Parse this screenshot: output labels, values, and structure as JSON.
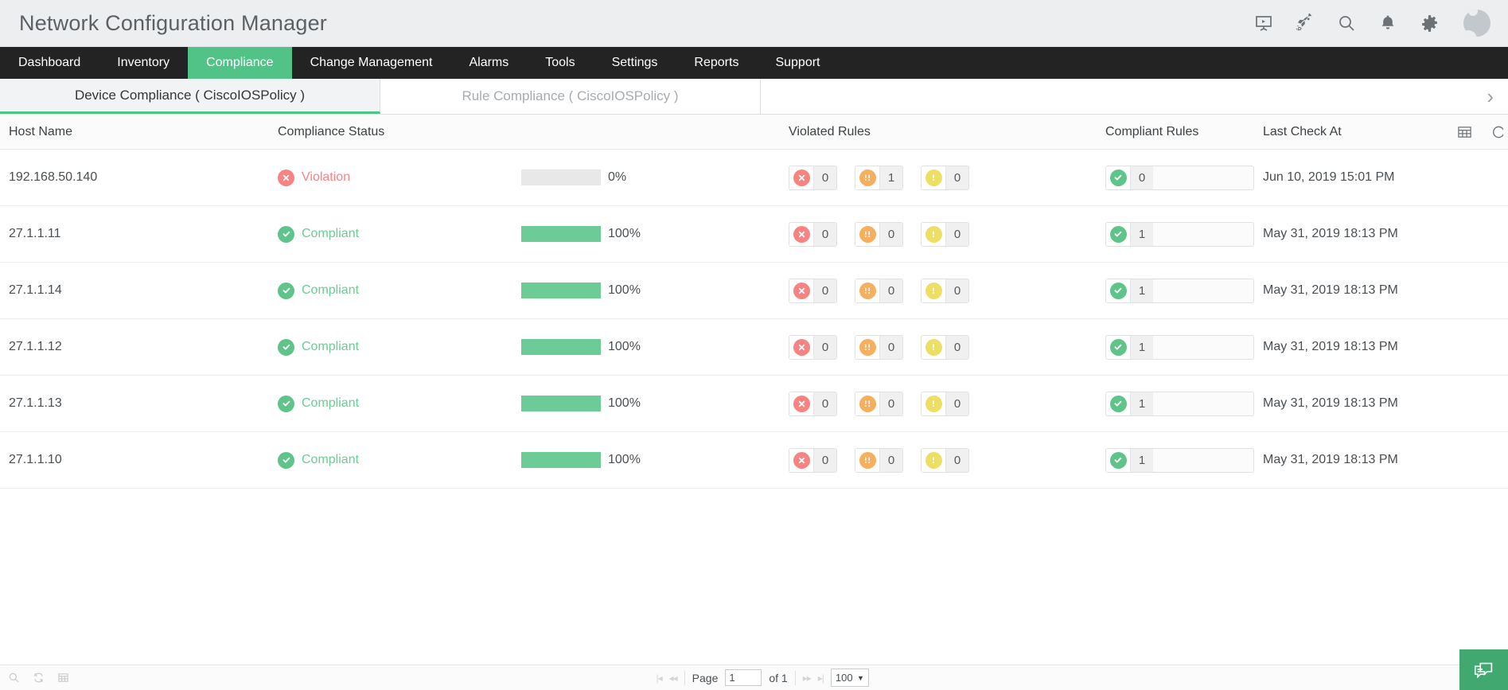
{
  "header": {
    "title": "Network Configuration Manager",
    "icons": [
      {
        "name": "presentation-icon"
      },
      {
        "name": "rocket-icon"
      },
      {
        "name": "search-icon"
      },
      {
        "name": "bell-icon"
      },
      {
        "name": "gear-icon"
      }
    ],
    "avatar_name": "user-avatar"
  },
  "nav": {
    "items": [
      {
        "label": "Dashboard",
        "active": false
      },
      {
        "label": "Inventory",
        "active": false
      },
      {
        "label": "Compliance",
        "active": true
      },
      {
        "label": "Change Management",
        "active": false
      },
      {
        "label": "Alarms",
        "active": false
      },
      {
        "label": "Tools",
        "active": false
      },
      {
        "label": "Settings",
        "active": false
      },
      {
        "label": "Reports",
        "active": false
      },
      {
        "label": "Support",
        "active": false
      }
    ],
    "active_color": "#51c387"
  },
  "subtabs": {
    "items": [
      {
        "label": "Device Compliance ( CiscoIOSPolicy )",
        "active": true
      },
      {
        "label": "Rule Compliance ( CiscoIOSPolicy )",
        "active": false
      }
    ],
    "close_glyph": "›"
  },
  "table": {
    "columns": [
      "Host Name",
      "Compliance Status",
      "",
      "Violated Rules",
      "Compliant Rules",
      "Last Check At"
    ],
    "rows": [
      {
        "host": "192.168.50.140",
        "status": "Violation",
        "status_type": "violation",
        "percent": "0%",
        "percent_value": 0,
        "violated": [
          {
            "severity": "critical",
            "count": "0"
          },
          {
            "severity": "major",
            "count": "1"
          },
          {
            "severity": "minor",
            "count": "0"
          }
        ],
        "compliant": "0",
        "last_check": "Jun 10, 2019 15:01 PM"
      },
      {
        "host": "27.1.1.11",
        "status": "Compliant",
        "status_type": "compliant",
        "percent": "100%",
        "percent_value": 100,
        "violated": [
          {
            "severity": "critical",
            "count": "0"
          },
          {
            "severity": "major",
            "count": "0"
          },
          {
            "severity": "minor",
            "count": "0"
          }
        ],
        "compliant": "1",
        "last_check": "May 31, 2019 18:13 PM"
      },
      {
        "host": "27.1.1.14",
        "status": "Compliant",
        "status_type": "compliant",
        "percent": "100%",
        "percent_value": 100,
        "violated": [
          {
            "severity": "critical",
            "count": "0"
          },
          {
            "severity": "major",
            "count": "0"
          },
          {
            "severity": "minor",
            "count": "0"
          }
        ],
        "compliant": "1",
        "last_check": "May 31, 2019 18:13 PM"
      },
      {
        "host": "27.1.1.12",
        "status": "Compliant",
        "status_type": "compliant",
        "percent": "100%",
        "percent_value": 100,
        "violated": [
          {
            "severity": "critical",
            "count": "0"
          },
          {
            "severity": "major",
            "count": "0"
          },
          {
            "severity": "minor",
            "count": "0"
          }
        ],
        "compliant": "1",
        "last_check": "May 31, 2019 18:13 PM"
      },
      {
        "host": "27.1.1.13",
        "status": "Compliant",
        "status_type": "compliant",
        "percent": "100%",
        "percent_value": 100,
        "violated": [
          {
            "severity": "critical",
            "count": "0"
          },
          {
            "severity": "major",
            "count": "0"
          },
          {
            "severity": "minor",
            "count": "0"
          }
        ],
        "compliant": "1",
        "last_check": "May 31, 2019 18:13 PM"
      },
      {
        "host": "27.1.1.10",
        "status": "Compliant",
        "status_type": "compliant",
        "percent": "100%",
        "percent_value": 100,
        "violated": [
          {
            "severity": "critical",
            "count": "0"
          },
          {
            "severity": "major",
            "count": "0"
          },
          {
            "severity": "minor",
            "count": "0"
          }
        ],
        "compliant": "1",
        "last_check": "May 31, 2019 18:13 PM"
      }
    ],
    "header_icons": [
      {
        "name": "column-chooser-icon"
      },
      {
        "name": "settings-circle-icon"
      }
    ]
  },
  "footer": {
    "left_icons": [
      {
        "name": "search-icon"
      },
      {
        "name": "refresh-icon"
      },
      {
        "name": "grid-icon"
      }
    ],
    "page_label": "Page",
    "page_value": "1",
    "of_label": "of 1",
    "page_size": "100",
    "first_glyph": "|◂",
    "prev_glyph": "◂◂",
    "next_glyph": "▸▸",
    "last_glyph": "▸|",
    "caret_glyph": "▼",
    "chat_name": "chat-widget-button"
  },
  "colors": {
    "accent": "#51c387",
    "violation": "#f98282",
    "compliant": "#6ccb96",
    "major": "#f6ae5f",
    "minor": "#ecdf63",
    "navbar": "#232323"
  }
}
